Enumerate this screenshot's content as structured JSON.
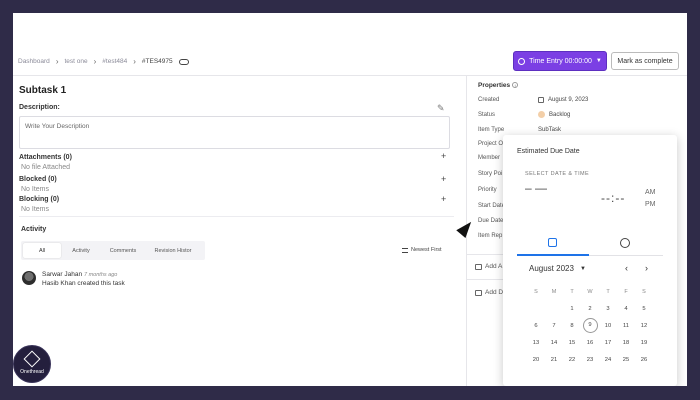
{
  "breadcrumb": {
    "items": [
      "Dashboard",
      "test one",
      "#test484",
      "#TES4975"
    ]
  },
  "header": {
    "time_entry_label": "Time Entry 00:00:00",
    "mark_complete_label": "Mark as complete"
  },
  "task": {
    "title": "Subtask 1",
    "description_label": "Description:",
    "description_placeholder": "Write Your Description"
  },
  "sections": [
    {
      "title": "Attachments (0)",
      "sub": "No file Attached"
    },
    {
      "title": "Blocked (0)",
      "sub": "No Items"
    },
    {
      "title": "Blocking (0)",
      "sub": "No Items"
    }
  ],
  "activity": {
    "title": "Activity",
    "tabs": [
      "All",
      "Activity",
      "Comments",
      "Revision Histor"
    ],
    "sort_label": "Newest First",
    "entries": [
      {
        "name": "Sarwar Jahan",
        "time": "7 months ago",
        "text": "Hasib Khan created this task"
      }
    ]
  },
  "properties": {
    "title": "Properties",
    "rows": [
      {
        "label": "Created",
        "value": "August 9, 2023"
      },
      {
        "label": "Status",
        "value": "Backlog"
      },
      {
        "label": "Item Type",
        "value": "SubTask"
      },
      {
        "label": "Project O",
        "value": ""
      },
      {
        "label": "Member",
        "value": ""
      },
      {
        "label": "Story Poi",
        "value": ""
      },
      {
        "label": "Priority",
        "value": ""
      },
      {
        "label": "Start Date",
        "value": ""
      },
      {
        "label": "Due Date",
        "value": ""
      },
      {
        "label": "Item Rep",
        "value": ""
      }
    ],
    "add_rows": [
      "Add A",
      "Add D"
    ]
  },
  "date_picker": {
    "title": "Estimated Due Date",
    "subtitle": "SELECT DATE & TIME",
    "date_placeholder": "– —",
    "time_placeholder": "--:--",
    "am_label": "AM",
    "pm_label": "PM",
    "month_label": "August 2023",
    "weekdays": [
      "S",
      "M",
      "T",
      "W",
      "T",
      "F",
      "S"
    ],
    "weeks": [
      [
        "",
        "",
        "1",
        "2",
        "3",
        "4",
        "5"
      ],
      [
        "6",
        "7",
        "8",
        "9",
        "10",
        "11",
        "12"
      ],
      [
        "13",
        "14",
        "15",
        "16",
        "17",
        "18",
        "19"
      ],
      [
        "20",
        "21",
        "22",
        "23",
        "24",
        "25",
        "26"
      ]
    ],
    "today": "9"
  },
  "logo": {
    "text": "Onethread"
  },
  "colors": {
    "accent": "#7b3fe4",
    "picker_accent": "#1e73e8",
    "backdrop": "#2f2b48"
  }
}
